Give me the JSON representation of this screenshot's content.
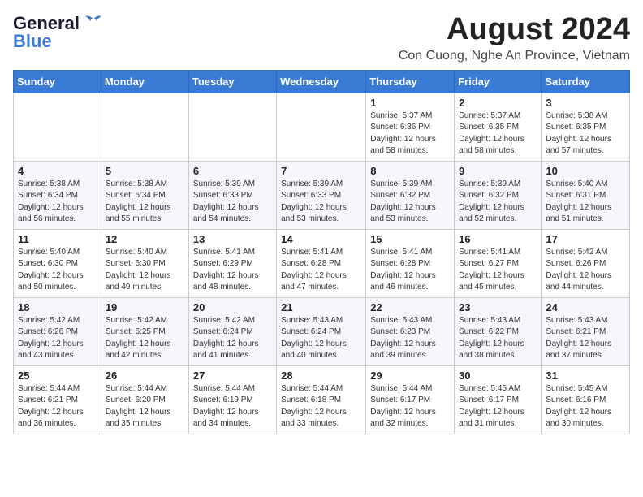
{
  "logo": {
    "line1": "General",
    "line2": "Blue"
  },
  "title": "August 2024",
  "subtitle": "Con Cuong, Nghe An Province, Vietnam",
  "days_of_week": [
    "Sunday",
    "Monday",
    "Tuesday",
    "Wednesday",
    "Thursday",
    "Friday",
    "Saturday"
  ],
  "weeks": [
    [
      {
        "day": "",
        "info": ""
      },
      {
        "day": "",
        "info": ""
      },
      {
        "day": "",
        "info": ""
      },
      {
        "day": "",
        "info": ""
      },
      {
        "day": "1",
        "info": "Sunrise: 5:37 AM\nSunset: 6:36 PM\nDaylight: 12 hours\nand 58 minutes."
      },
      {
        "day": "2",
        "info": "Sunrise: 5:37 AM\nSunset: 6:35 PM\nDaylight: 12 hours\nand 58 minutes."
      },
      {
        "day": "3",
        "info": "Sunrise: 5:38 AM\nSunset: 6:35 PM\nDaylight: 12 hours\nand 57 minutes."
      }
    ],
    [
      {
        "day": "4",
        "info": "Sunrise: 5:38 AM\nSunset: 6:34 PM\nDaylight: 12 hours\nand 56 minutes."
      },
      {
        "day": "5",
        "info": "Sunrise: 5:38 AM\nSunset: 6:34 PM\nDaylight: 12 hours\nand 55 minutes."
      },
      {
        "day": "6",
        "info": "Sunrise: 5:39 AM\nSunset: 6:33 PM\nDaylight: 12 hours\nand 54 minutes."
      },
      {
        "day": "7",
        "info": "Sunrise: 5:39 AM\nSunset: 6:33 PM\nDaylight: 12 hours\nand 53 minutes."
      },
      {
        "day": "8",
        "info": "Sunrise: 5:39 AM\nSunset: 6:32 PM\nDaylight: 12 hours\nand 53 minutes."
      },
      {
        "day": "9",
        "info": "Sunrise: 5:39 AM\nSunset: 6:32 PM\nDaylight: 12 hours\nand 52 minutes."
      },
      {
        "day": "10",
        "info": "Sunrise: 5:40 AM\nSunset: 6:31 PM\nDaylight: 12 hours\nand 51 minutes."
      }
    ],
    [
      {
        "day": "11",
        "info": "Sunrise: 5:40 AM\nSunset: 6:30 PM\nDaylight: 12 hours\nand 50 minutes."
      },
      {
        "day": "12",
        "info": "Sunrise: 5:40 AM\nSunset: 6:30 PM\nDaylight: 12 hours\nand 49 minutes."
      },
      {
        "day": "13",
        "info": "Sunrise: 5:41 AM\nSunset: 6:29 PM\nDaylight: 12 hours\nand 48 minutes."
      },
      {
        "day": "14",
        "info": "Sunrise: 5:41 AM\nSunset: 6:28 PM\nDaylight: 12 hours\nand 47 minutes."
      },
      {
        "day": "15",
        "info": "Sunrise: 5:41 AM\nSunset: 6:28 PM\nDaylight: 12 hours\nand 46 minutes."
      },
      {
        "day": "16",
        "info": "Sunrise: 5:41 AM\nSunset: 6:27 PM\nDaylight: 12 hours\nand 45 minutes."
      },
      {
        "day": "17",
        "info": "Sunrise: 5:42 AM\nSunset: 6:26 PM\nDaylight: 12 hours\nand 44 minutes."
      }
    ],
    [
      {
        "day": "18",
        "info": "Sunrise: 5:42 AM\nSunset: 6:26 PM\nDaylight: 12 hours\nand 43 minutes."
      },
      {
        "day": "19",
        "info": "Sunrise: 5:42 AM\nSunset: 6:25 PM\nDaylight: 12 hours\nand 42 minutes."
      },
      {
        "day": "20",
        "info": "Sunrise: 5:42 AM\nSunset: 6:24 PM\nDaylight: 12 hours\nand 41 minutes."
      },
      {
        "day": "21",
        "info": "Sunrise: 5:43 AM\nSunset: 6:24 PM\nDaylight: 12 hours\nand 40 minutes."
      },
      {
        "day": "22",
        "info": "Sunrise: 5:43 AM\nSunset: 6:23 PM\nDaylight: 12 hours\nand 39 minutes."
      },
      {
        "day": "23",
        "info": "Sunrise: 5:43 AM\nSunset: 6:22 PM\nDaylight: 12 hours\nand 38 minutes."
      },
      {
        "day": "24",
        "info": "Sunrise: 5:43 AM\nSunset: 6:21 PM\nDaylight: 12 hours\nand 37 minutes."
      }
    ],
    [
      {
        "day": "25",
        "info": "Sunrise: 5:44 AM\nSunset: 6:21 PM\nDaylight: 12 hours\nand 36 minutes."
      },
      {
        "day": "26",
        "info": "Sunrise: 5:44 AM\nSunset: 6:20 PM\nDaylight: 12 hours\nand 35 minutes."
      },
      {
        "day": "27",
        "info": "Sunrise: 5:44 AM\nSunset: 6:19 PM\nDaylight: 12 hours\nand 34 minutes."
      },
      {
        "day": "28",
        "info": "Sunrise: 5:44 AM\nSunset: 6:18 PM\nDaylight: 12 hours\nand 33 minutes."
      },
      {
        "day": "29",
        "info": "Sunrise: 5:44 AM\nSunset: 6:17 PM\nDaylight: 12 hours\nand 32 minutes."
      },
      {
        "day": "30",
        "info": "Sunrise: 5:45 AM\nSunset: 6:17 PM\nDaylight: 12 hours\nand 31 minutes."
      },
      {
        "day": "31",
        "info": "Sunrise: 5:45 AM\nSunset: 6:16 PM\nDaylight: 12 hours\nand 30 minutes."
      }
    ]
  ]
}
